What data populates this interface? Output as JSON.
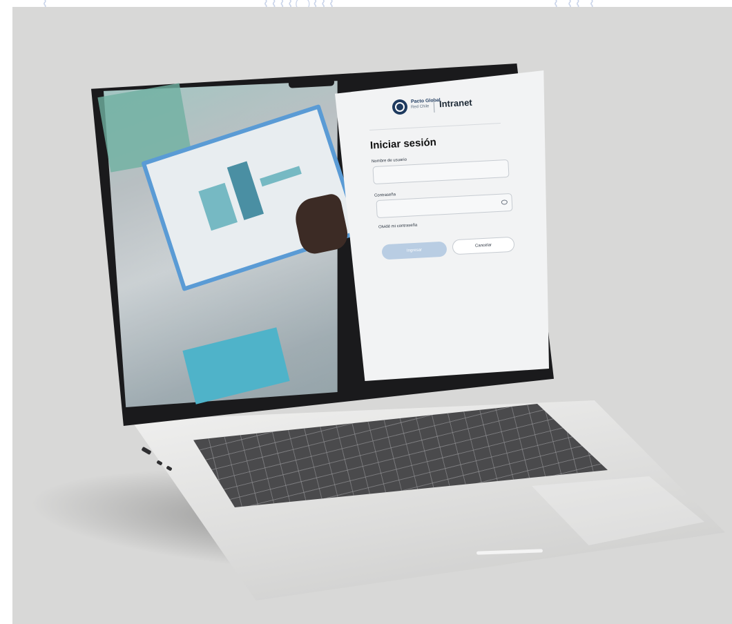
{
  "brand": {
    "line1": "Pacto Global",
    "line2": "Red Chile",
    "product": "Intranet"
  },
  "login": {
    "title": "Iniciar sesión",
    "username_label": "Nombre de usuario",
    "username_value": "",
    "password_label": "Contraseña",
    "password_value": "",
    "forgot_link": "Olvidé mi contraseña",
    "submit_label": "Ingresar",
    "cancel_label": "Cancelar"
  },
  "icons": {
    "password_toggle": "eye-icon",
    "logo": "globe-logo-icon"
  },
  "colors": {
    "primary_disabled": "#b9cde3",
    "panel_bg": "#f2f3f4",
    "brand_navy": "#1e3a5f"
  }
}
